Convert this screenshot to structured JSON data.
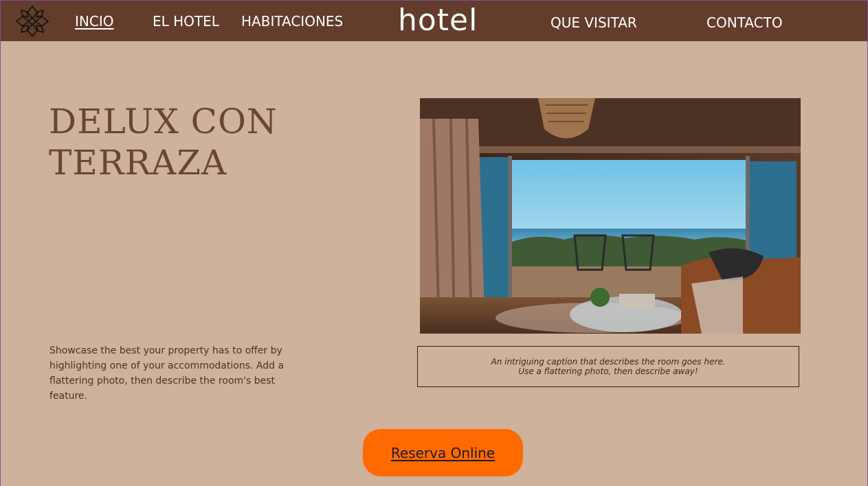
{
  "header": {
    "logo_icon": "ornament-logo-icon",
    "brand": "hotel",
    "nav": [
      {
        "label": "INCIO",
        "active": true
      },
      {
        "label": "EL HOTEL",
        "active": false
      },
      {
        "label": "HABITACIONES",
        "active": false
      },
      {
        "label": "QUE VISITAR",
        "active": false
      },
      {
        "label": "CONTACTO",
        "active": false
      }
    ]
  },
  "main": {
    "title_line1": "DELUX CON",
    "title_line2": "TERRAZA",
    "description": "Showcase the best your property has to offer by highlighting one of your accommodations. Add a flattering photo, then describe the room's best feature.",
    "photo_alt": "room-photo",
    "caption_line1": "An intriguing caption that describes the room goes here.",
    "caption_line2": "Use a flattering photo, then describe away!",
    "book_button": "Reserva Online"
  },
  "colors": {
    "navbar": "#633c2b",
    "background": "#ceb29b",
    "accent": "#ff6a00",
    "title": "#6a4533"
  }
}
